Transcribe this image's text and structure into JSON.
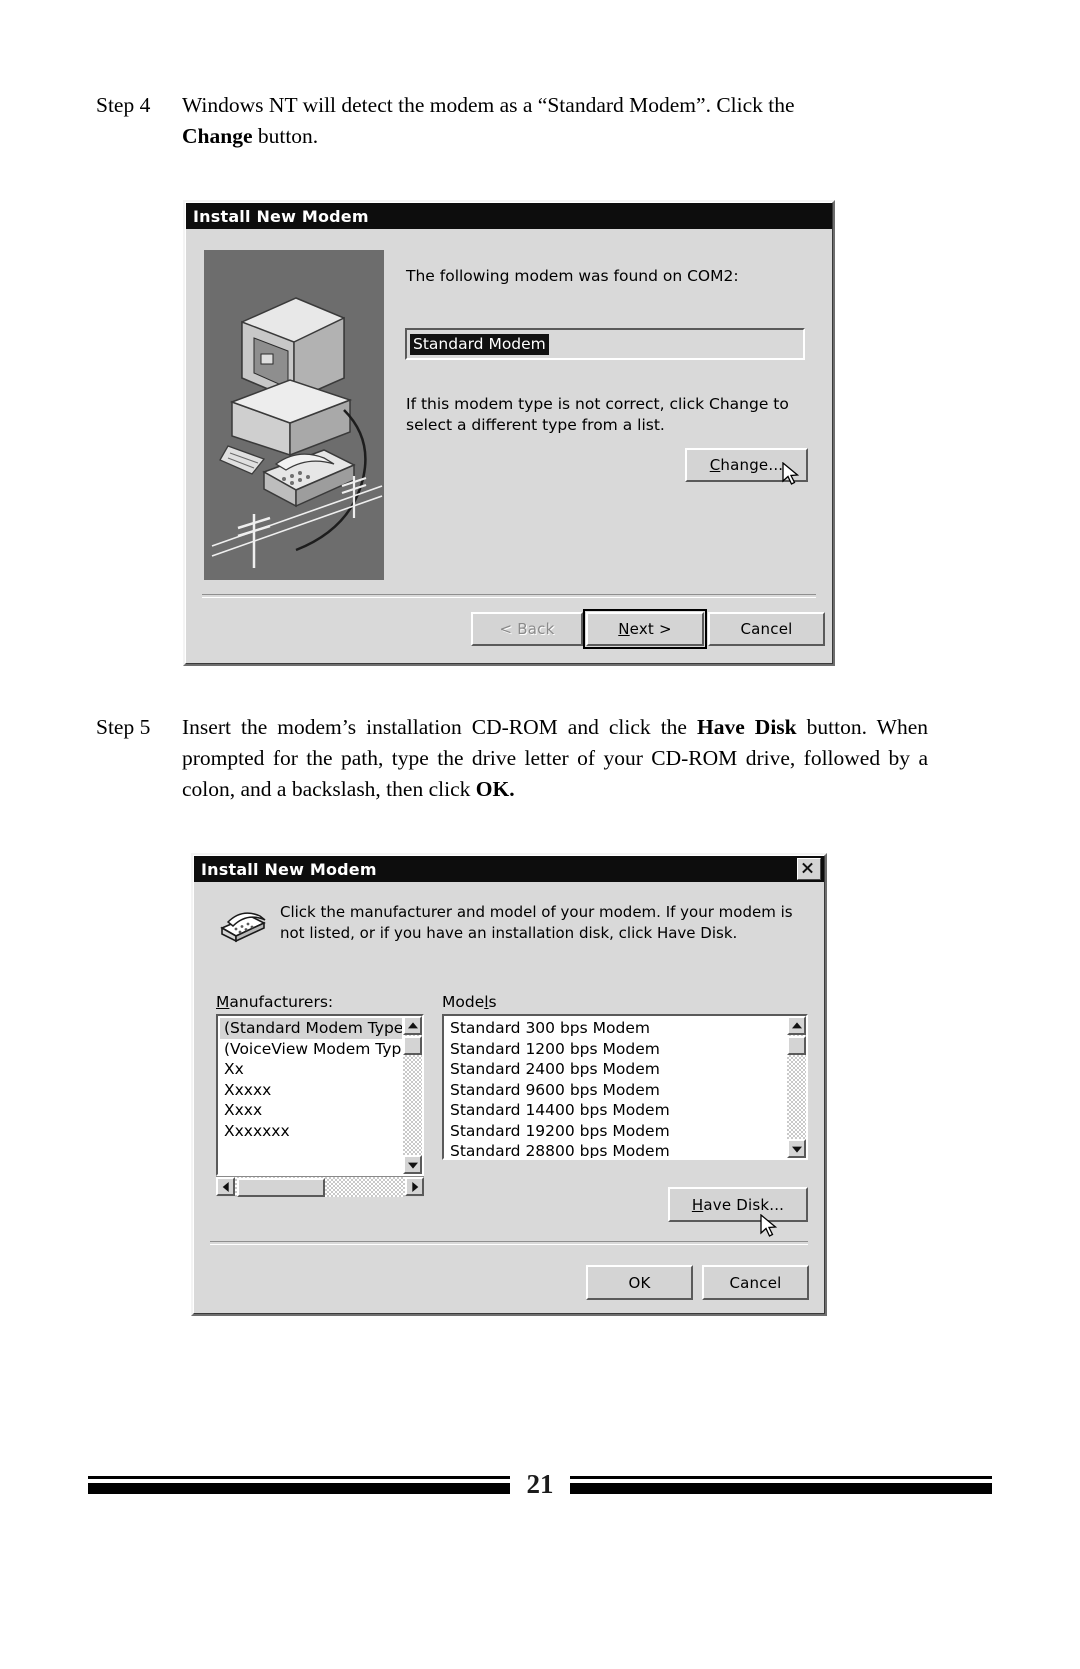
{
  "page": {
    "number": "21"
  },
  "steps": [
    {
      "label": "Step 4",
      "line1_a": "Windows NT will detect the modem as a “Standard Modem”. Click the ",
      "line2_bold": "Change",
      "line2_b": " button."
    },
    {
      "label": "Step 5",
      "para_a": "Insert the modem’s installation CD-ROM and click the ",
      "para_bold1": "Have Disk",
      "para_b": " button. When prompted for the path, type the drive letter of your CD-ROM drive, followed by a colon, and a backslash, then click ",
      "para_bold2": "OK."
    }
  ],
  "dialog1": {
    "title": "Install New Modem",
    "found_label": "The following modem was found on COM2:",
    "modem_value": "Standard Modem",
    "hint": "If this modem type is not correct, click Change to select a different type from a list.",
    "change_button": "Change...",
    "change_button_accel": "C",
    "back_button": "< Back",
    "back_button_accel": "B",
    "next_button": "Next >",
    "next_button_accel": "N",
    "cancel_button": "Cancel",
    "illustration_alt": "computer-and-telephone-illustration"
  },
  "dialog2": {
    "title": "Install New Modem",
    "close_label": "×",
    "instruction": "Click the manufacturer and model of your modem. If your modem is not listed, or if you have an installation disk, click Have Disk.",
    "manufacturers_label": "Manufacturers:",
    "manufacturers_accel": "M",
    "models_label": "Models",
    "models_accel": "l",
    "manufacturers": [
      "(Standard Modem Types)",
      "(VoiceView Modem Types)",
      "Xx",
      "Xxxxx",
      "Xxxx",
      "Xxxxxxx"
    ],
    "manufacturers_selected_index": 0,
    "models": [
      "Standard   300 bps Modem",
      "Standard  1200 bps Modem",
      "Standard  2400 bps Modem",
      "Standard  9600 bps Modem",
      "Standard 14400 bps Modem",
      "Standard 19200 bps Modem",
      "Standard 28800 bps Modem"
    ],
    "have_disk_button": "Have Disk...",
    "have_disk_accel": "H",
    "ok_button": "OK",
    "cancel_button": "Cancel"
  },
  "colors": {
    "dialog_face": "#d9d9d9",
    "titlebar": "#0d0d0d",
    "picture_bg": "#6d6d6d",
    "selection": "#111111"
  }
}
